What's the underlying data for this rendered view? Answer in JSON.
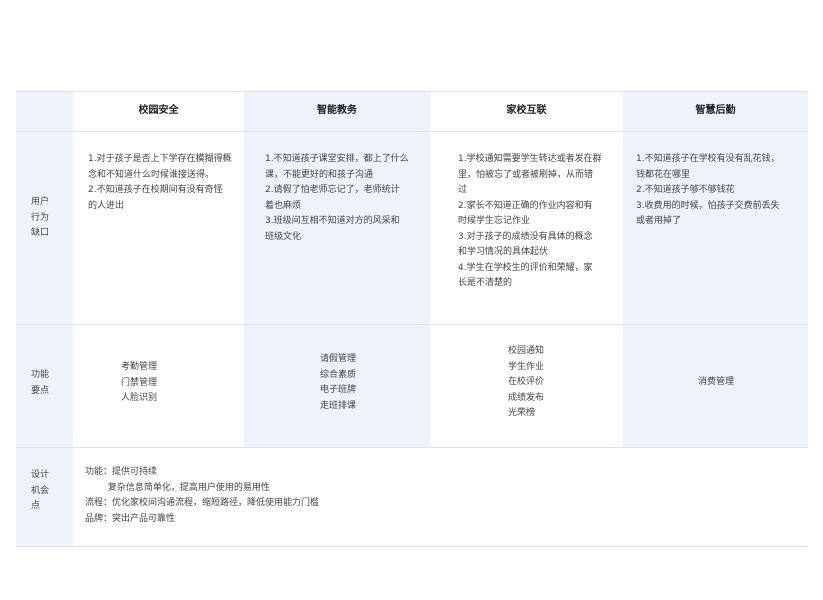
{
  "columns": [
    "校园安全",
    "智能教务",
    "家校互联",
    "智慧后勤"
  ],
  "rows": {
    "pain": {
      "label": "用户\n行为\n缺口",
      "cells": [
        "1.对于孩子是否上下学存在模糊得概\n念和不知道什么时候谁接送得。\n2.不知道孩子在校期间有没有奇怪\n的人进出",
        "1.不知道孩子课堂安排，都上了什么\n课，不能更好的和孩子沟通\n2.请假了怕老师忘记了，老师统计\n着也麻烦\n3.班级间互相不知道对方的风采和\n班级文化",
        "1.学校通知需要学生转达或者发在群\n里，怕被忘了或者被刷掉，从而错\n过\n2.家长不知道正确的作业内容和有\n时候学生忘记作业\n3.对于孩子的成绩没有具体的概念\n和学习情况的具体起伏\n4.学生在学校生的评价和荣耀，家\n长是不清楚的",
        "1.不知道孩子在学校有没有乱花钱，\n钱都花在哪里\n2.不知道孩子够不够钱花\n3.收费用的时候，怕孩子交费前丢失\n或者用掉了"
      ]
    },
    "features": {
      "label": "功能\n要点",
      "cells": [
        "考勤管理\n门禁管理\n人脸识别",
        "请假管理\n综合素质\n电子班牌\n走班排课",
        "校园通知\n学生作业\n在校评价\n成绩发布\n光荣榜",
        "消费管理"
      ]
    },
    "design": {
      "label": "设计\n机会\n点",
      "lines": [
        "功能：提供可持续",
        "        复杂信息简单化，提高用户使用的易用性",
        "流程：优化家校间沟通流程，缩短路径，降低使用能力门槛",
        "品牌：突出产品可靠性"
      ]
    }
  }
}
